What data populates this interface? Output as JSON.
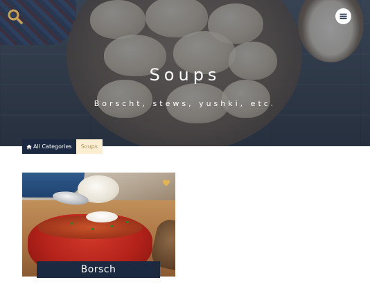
{
  "hero": {
    "title": "Soups",
    "subtitle": "Borscht, stews, yushki, etc."
  },
  "header": {
    "search_icon": "search-icon",
    "menu_icon": "hamburger-menu-icon"
  },
  "breadcrumb": {
    "home_icon": "home-icon",
    "home_label": "All Categories",
    "current_label": "Soups"
  },
  "recipes": [
    {
      "name": "Borsch",
      "favorite_icon": "heart-icon"
    }
  ],
  "colors": {
    "navy": "#1b2a40",
    "breadcrumb_current_bg": "#fbeed3",
    "breadcrumb_current_text": "#b29462",
    "heart": "#e2b453",
    "search_icon": "#c9a05a"
  }
}
